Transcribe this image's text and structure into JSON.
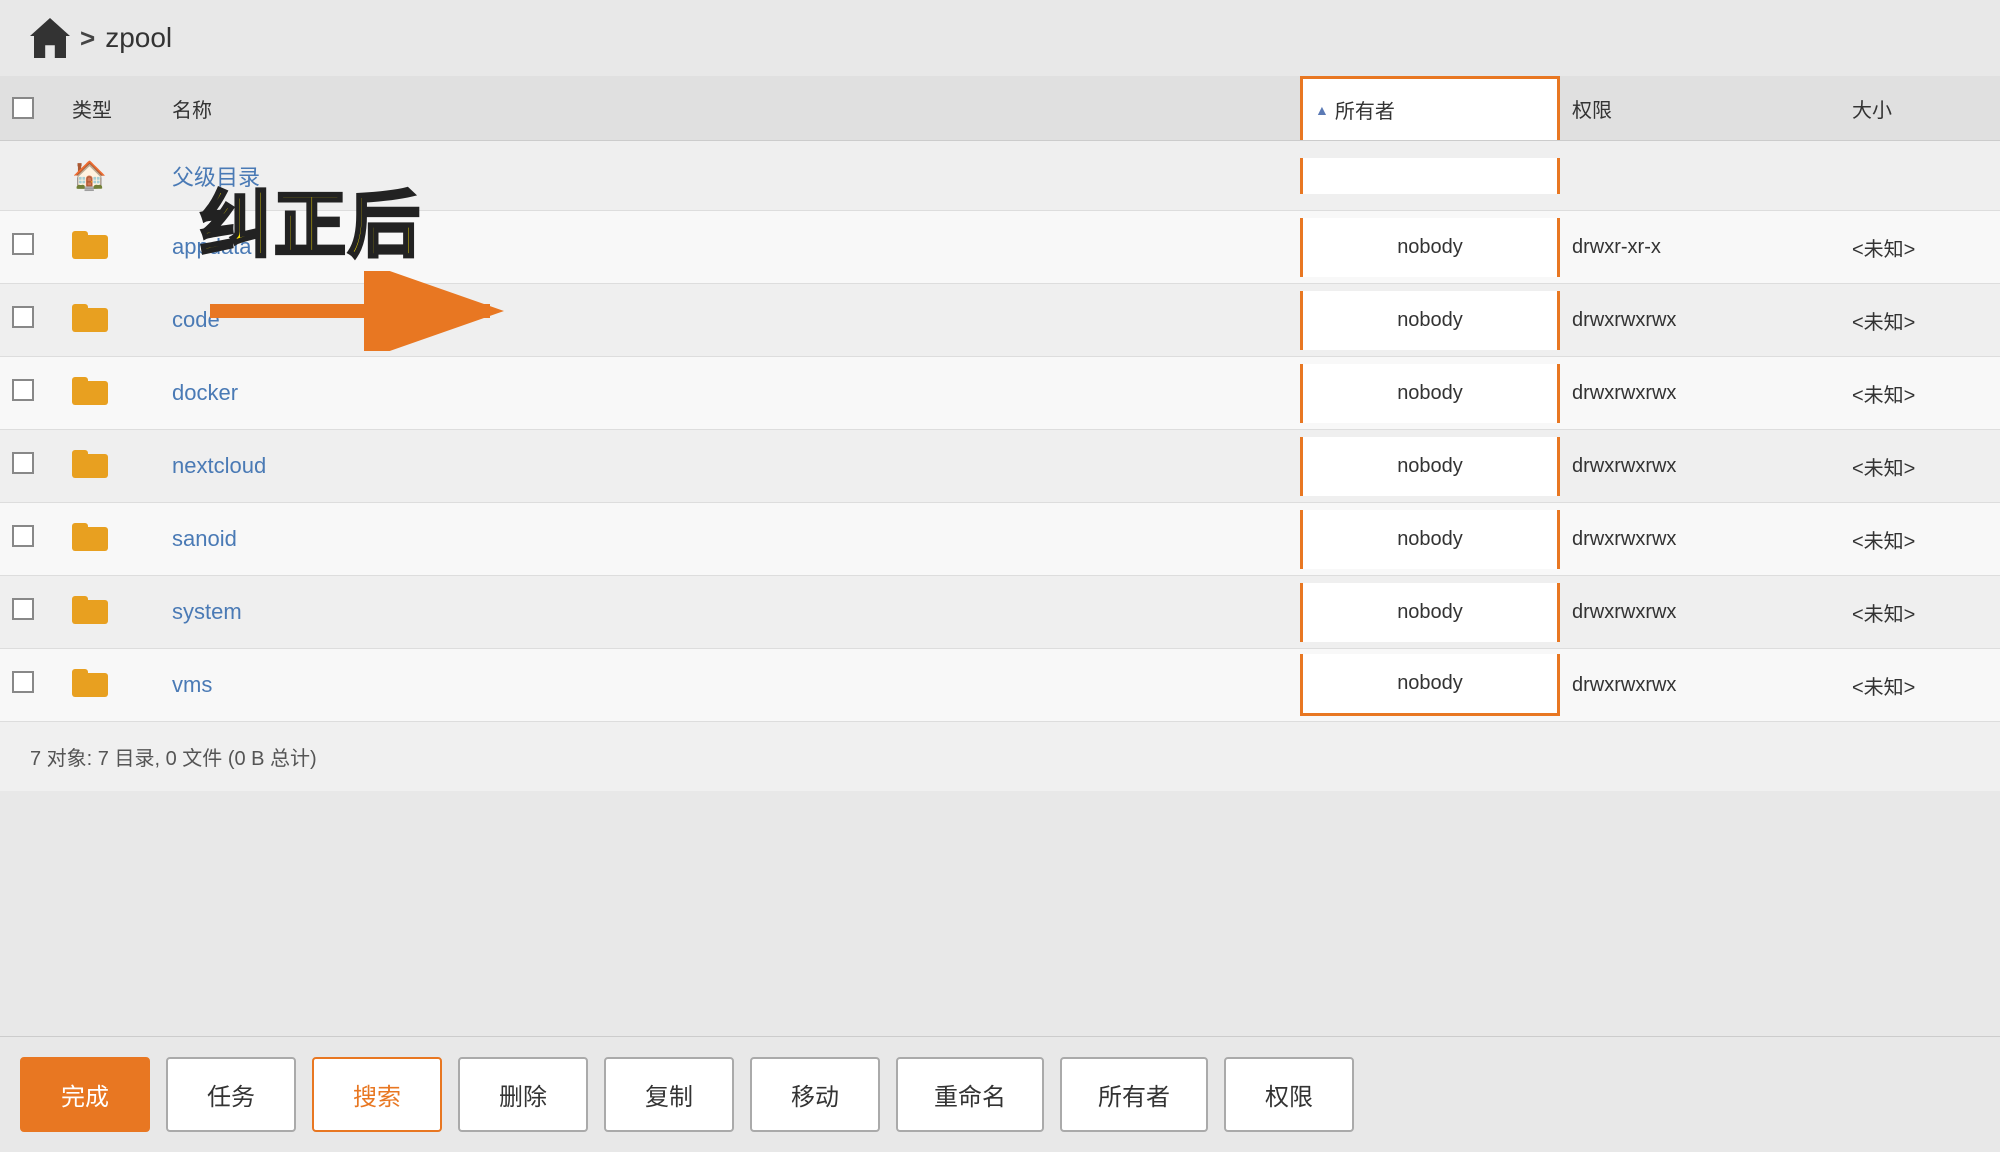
{
  "breadcrumb": {
    "home_label": "home",
    "separator": ">",
    "path": "zpool"
  },
  "table": {
    "columns": {
      "checkbox": "",
      "type": "类型",
      "name": "名称",
      "owner": "所有者",
      "permissions": "权限",
      "size": "大小"
    },
    "sort_indicator": "▲",
    "rows": [
      {
        "id": "parent",
        "type": "parent",
        "name": "父级目录",
        "owner": "",
        "permissions": "",
        "size": ""
      },
      {
        "id": "appdata",
        "type": "folder",
        "name": "appdata",
        "owner": "nobody",
        "permissions": "drwxr-xr-x",
        "size": "<未知>"
      },
      {
        "id": "code",
        "type": "folder",
        "name": "code",
        "owner": "nobody",
        "permissions": "drwxrwxrwx",
        "size": "<未知>"
      },
      {
        "id": "docker",
        "type": "folder",
        "name": "docker",
        "owner": "nobody",
        "permissions": "drwxrwxrwx",
        "size": "<未知>"
      },
      {
        "id": "nextcloud",
        "type": "folder",
        "name": "nextcloud",
        "owner": "nobody",
        "permissions": "drwxrwxrwx",
        "size": "<未知>"
      },
      {
        "id": "sanoid",
        "type": "folder",
        "name": "sanoid",
        "owner": "nobody",
        "permissions": "drwxrwxrwx",
        "size": "<未知>"
      },
      {
        "id": "system",
        "type": "folder",
        "name": "system",
        "owner": "nobody",
        "permissions": "drwxrwxrwx",
        "size": "<未知>"
      },
      {
        "id": "vms",
        "type": "folder",
        "name": "vms",
        "owner": "nobody",
        "permissions": "drwxrwxrwx",
        "size": "<未知>"
      }
    ]
  },
  "status": "7 对象: 7 目录, 0 文件 (0 B 总计)",
  "annotation": {
    "text": "纠正后"
  },
  "toolbar": {
    "buttons": [
      {
        "id": "done",
        "label": "完成",
        "style": "primary"
      },
      {
        "id": "tasks",
        "label": "任务",
        "style": "default"
      },
      {
        "id": "search",
        "label": "搜索",
        "style": "outline-primary"
      },
      {
        "id": "delete",
        "label": "删除",
        "style": "default"
      },
      {
        "id": "copy",
        "label": "复制",
        "style": "default"
      },
      {
        "id": "move",
        "label": "移动",
        "style": "default"
      },
      {
        "id": "rename",
        "label": "重命名",
        "style": "default"
      },
      {
        "id": "owner",
        "label": "所有者",
        "style": "default"
      },
      {
        "id": "perms",
        "label": "权限",
        "style": "default"
      }
    ]
  }
}
